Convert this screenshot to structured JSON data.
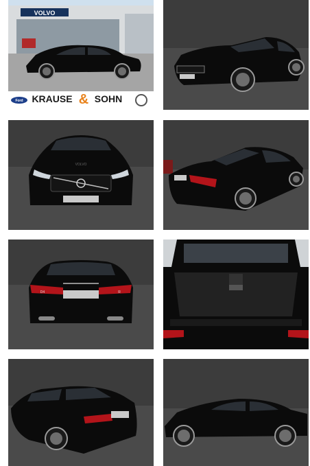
{
  "gallery": {
    "images": [
      {
        "view": "dealer-side"
      },
      {
        "view": "front-three-quarter"
      },
      {
        "view": "front"
      },
      {
        "view": "rear-three-quarter"
      },
      {
        "view": "rear"
      },
      {
        "view": "trunk-open"
      },
      {
        "view": "rear-left-three-quarter"
      },
      {
        "view": "side"
      }
    ]
  },
  "dealer": {
    "brand_sign": "VOLVO",
    "name_left": "KRAUSE",
    "ampersand": "&",
    "name_right": "SOHN",
    "left_logo": "Ford",
    "right_logo": "volvo-logo"
  },
  "car": {
    "front_emblem": "VOLVO",
    "rear_badge_left": "D4",
    "rear_badge_right": "R"
  },
  "colors": {
    "car_paint": "#0b0b0b",
    "studio_wall": "#3c3c3c",
    "studio_floor": "#4a4a4a",
    "taillight": "#b3141a",
    "dealer_orange": "#e8821c",
    "ford_blue": "#1d3f8a"
  }
}
